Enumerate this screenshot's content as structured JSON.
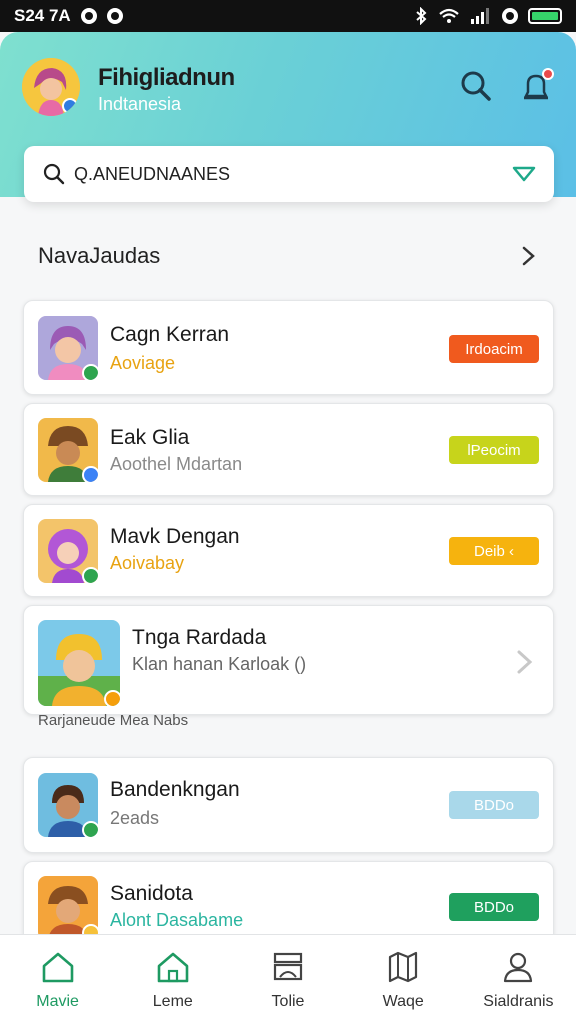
{
  "status_bar": {
    "time": "S24 7A"
  },
  "header": {
    "title": "Fihigliadnun",
    "subtitle": "Indtanesia"
  },
  "search": {
    "value": "Q.ANEUDNAANES"
  },
  "section": {
    "title": "NavaJaudas"
  },
  "cards": [
    {
      "name": "Cagn Kerran",
      "sub": "Aoviage",
      "sub_color": "#e8a312",
      "badge": "Irdoacim",
      "badge_color": "#f05a1e",
      "avatar_color": "#e89ad0",
      "mini_color": "#2ea44f"
    },
    {
      "name": "Eak Glia",
      "sub": "Aoothel Mdartan",
      "sub_color": "#8a8a8a",
      "badge": "lPeocim",
      "badge_color": "#c7d41b",
      "avatar_color": "#f1b94a",
      "mini_color": "#3b82f6"
    },
    {
      "name": "Mavk Dengan",
      "sub": "Aoivabay",
      "sub_color": "#e8a312",
      "badge": "Deib ‹",
      "badge_color": "#f6b30e",
      "avatar_color": "#f3c46a",
      "mini_color": "#2ea44f"
    },
    {
      "name": "Tnga Rardada",
      "sub": "Klan hanan Karloak ()",
      "sub_color": "#666666",
      "badge": "",
      "badge_color": "",
      "avatar_color": "#7cc9e9",
      "mini_color": "#f59e0b"
    },
    {
      "name": "Bandenkngan",
      "sub": "2eads",
      "sub_color": "#777777",
      "badge": "BDDo",
      "badge_color": "#a9d8ea",
      "avatar_color": "#6fbde0",
      "mini_color": "#2ea44f"
    },
    {
      "name": "Sanidota",
      "sub": "Alont Dasabame",
      "sub_color": "#2bb5a0",
      "badge": "BDDo",
      "badge_color": "#1fa05e",
      "avatar_color": "#f4a43a",
      "mini_color": "#f6c13a"
    }
  ],
  "caption": "Rarjaneude Mea Nabs",
  "nav": [
    {
      "label": "Mavie",
      "icon": "home-icon"
    },
    {
      "label": "Leme",
      "icon": "house-icon"
    },
    {
      "label": "Tolie",
      "icon": "layers-icon"
    },
    {
      "label": "Waqe",
      "icon": "map-icon"
    },
    {
      "label": "Sialdranis",
      "icon": "user-icon"
    }
  ]
}
